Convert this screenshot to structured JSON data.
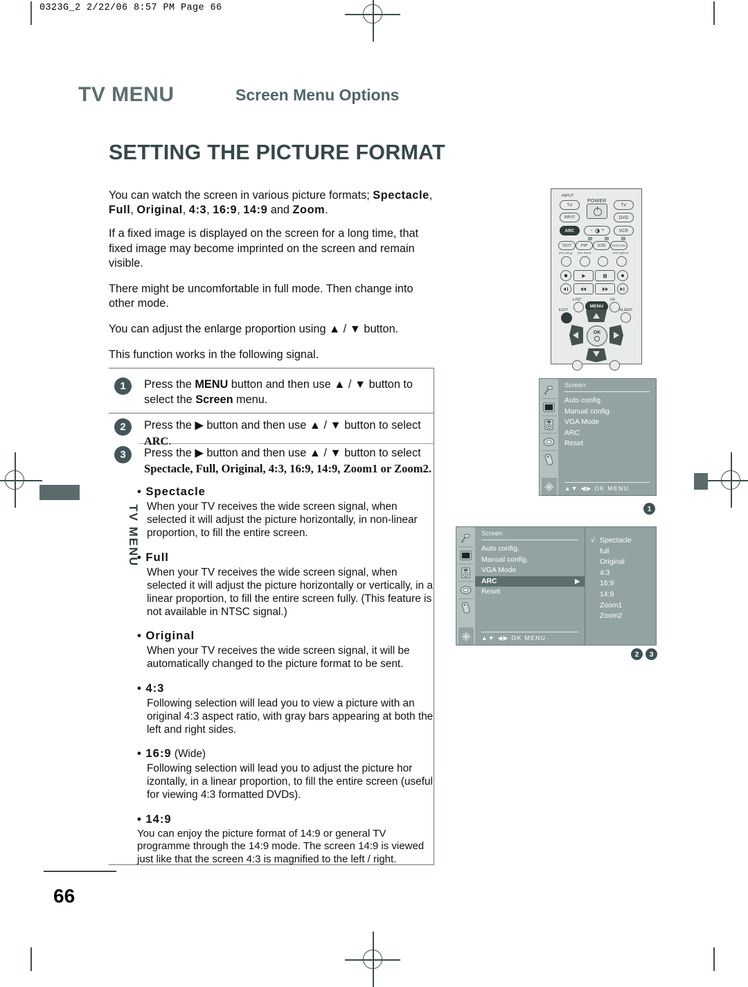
{
  "print": {
    "file_stamp": "0323G_2  2/22/06  8:57 PM  Page 66"
  },
  "header": {
    "section": "TV MENU",
    "subtitle": "Screen Menu Options",
    "title": "SETTING THE PICTURE FORMAT",
    "side_tab": "TV MENU"
  },
  "intro": {
    "p1_a": "You can watch the screen in various picture formats; ",
    "p1_b1": "Spectacle",
    "p1_b2": "Full",
    "p1_b3": "Original",
    "p1_b4": "4:3",
    "p1_b5": "16:9",
    "p1_b6": "14:9",
    "p1_b7": "Zoom",
    "p1_sep1": ", ",
    "p1_sep2": " and ",
    "p1_end": ".",
    "p2": "If a fixed image is displayed on the screen for a long time, that fixed image may become imprinted on the screen and remain visible.",
    "p3": "There might be uncomfortable in full mode. Then change into other mode.",
    "p4_a": "You can adjust the enlarge proportion using ",
    "p4_up": "▲",
    "p4_slash": " / ",
    "p4_down": "▼",
    "p4_b": " button.",
    "p5": "This function works in the following signal."
  },
  "steps": [
    {
      "number": "1",
      "a": "Press the ",
      "bold1": "MENU",
      "b": " button and then use ",
      "up": "▲",
      "slash": " / ",
      "down": "▼",
      "c": " button to select the ",
      "bold2": "Screen",
      "d": " menu."
    },
    {
      "number": "2",
      "a": "Press the ",
      "arrow": "▶",
      "b": " button and then use ",
      "up": "▲",
      "slash": " / ",
      "down": "▼",
      "c": " button to select ",
      "bold2": "ARC",
      "d": "."
    },
    {
      "number": "3",
      "a": "Press the ",
      "arrow": "▶",
      "b": " button and then use ",
      "up": "▲",
      "slash": " / ",
      "down": "▼",
      "c": " button to select",
      "options": "Spectacle, Full, Original, 4:3, 16:9, 14:9, Zoom1 or Zoom2."
    }
  ],
  "formats": [
    {
      "name": "Spectacle",
      "suffix": "",
      "desc": "When your TV receives the wide screen signal, when selected it will adjust the picture horizontally, in non-linear proportion, to fill the entire screen."
    },
    {
      "name": "Full",
      "suffix": "",
      "desc": "When your TV receives the wide screen signal, when selected it will adjust the picture horizontally or vertically, in a linear proportion, to fill the entire screen fully. (This feature is not available in NTSC signal.)"
    },
    {
      "name": "Original",
      "suffix": "",
      "desc": "When your TV receives the wide screen signal, it will be automatically changed to the picture format to be sent."
    },
    {
      "name": "4:3",
      "suffix": "",
      "desc": "Following selection will lead you to view a picture with an original 4:3 aspect ratio, with gray bars appearing at both the left and right sides."
    },
    {
      "name": "16:9",
      "suffix": " (Wide)",
      "desc": "Following selection will lead you to adjust the picture hor izontally, in a linear proportion, to fill the entire screen (useful for viewing 4:3 formatted DVDs)."
    },
    {
      "name": "14:9",
      "suffix": "",
      "desc": "You can enjoy the picture format of 14:9 or general TV programme through the 14:9 mode. The screen 14:9 is viewed just like that the screen 4:3 is magnified to the left / right."
    }
  ],
  "remote": {
    "input_label": "INPUT",
    "keys": {
      "tv_left": "TV",
      "power": "POWER",
      "tv_right": "TV",
      "input": "INPUT",
      "dvd": "DVD",
      "arc": "ARC",
      "vcr": "VCR",
      "brightness_minus": "−",
      "brightness_plus": "+",
      "text": "TEXT",
      "pip": "PIP",
      "size": "SIZE",
      "position": "POSITION",
      "list": "LIST",
      "menu": "MENU",
      "exit": "EXIT",
      "sleep": "SLEEP",
      "mute": "I/II",
      "ok": "OK"
    },
    "tiny_labels": {
      "pip_prs_1": "PIP PR▲",
      "pip_prs_2": "PIP PR▼",
      "pip_input": "PIP INPUT"
    }
  },
  "osd": {
    "title": "Screen",
    "items": [
      "Auto config.",
      "Manual config.",
      "VGA Mode",
      "ARC",
      "Reset"
    ],
    "highlighted_item": "ARC",
    "submenu_arrow": "▶",
    "footer": "▲▼  ◀▶  OK  MENU",
    "submenu": {
      "check": "√",
      "options": [
        "Spectacle",
        "full",
        "Original",
        "4:3",
        "16:9",
        "14:9",
        "Zoom1",
        "Zoom2"
      ],
      "selected": "Spectacle"
    },
    "step_badge_1": "1",
    "step_badge_2": "2",
    "step_badge_3": "3"
  },
  "footer": {
    "page_number": "66"
  },
  "colors": {
    "heading_teal": "#5d6e6e",
    "title_dark": "#36474a",
    "badge": "#44565a",
    "osd_bg": "#93a3a3",
    "osd_highlight": "#5c6e6e"
  }
}
